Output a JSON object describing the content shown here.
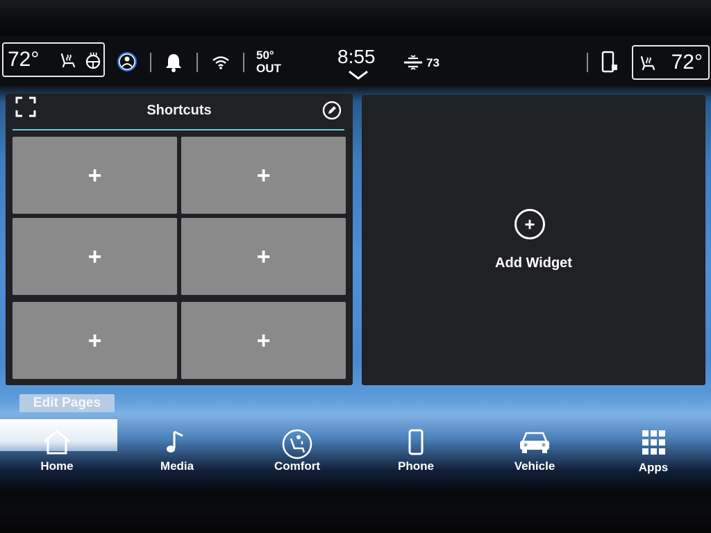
{
  "status_bar": {
    "driver_temp": "72°",
    "passenger_temp": "72°",
    "outside_temp": "50°",
    "outside_label": "OUT",
    "clock": "8:55",
    "fan_value": "73"
  },
  "shortcuts": {
    "title": "Shortcuts",
    "tiles": [
      "+",
      "+",
      "+",
      "+",
      "+",
      "+"
    ]
  },
  "widget": {
    "add_label": "Add Widget",
    "add_symbol": "+"
  },
  "edit_pages_label": "Edit Pages",
  "nav": {
    "items": [
      {
        "label": "Home",
        "icon": "home-icon",
        "active": true
      },
      {
        "label": "Media",
        "icon": "music-note-icon"
      },
      {
        "label": "Comfort",
        "icon": "comfort-seat-icon"
      },
      {
        "label": "Phone",
        "icon": "phone-icon"
      },
      {
        "label": "Vehicle",
        "icon": "car-icon"
      },
      {
        "label": "Apps",
        "icon": "apps-grid-icon"
      }
    ]
  },
  "colors": {
    "panel_bg": "#202124",
    "tile_bg": "#8a8a8a",
    "accent_line": "#6fc6dd",
    "background_blue": "#4e8fd6"
  }
}
